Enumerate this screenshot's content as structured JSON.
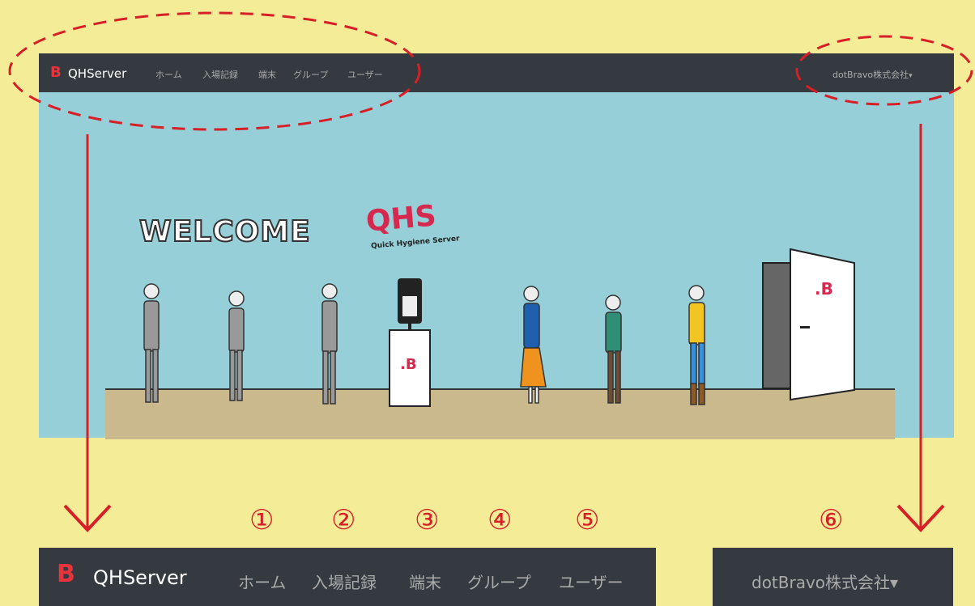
{
  "navbar": {
    "brand_mark": "B",
    "brand_name": "QHServer",
    "items": [
      {
        "label": "ホーム",
        "number": "①"
      },
      {
        "label": "入場記録",
        "number": "②"
      },
      {
        "label": "端末",
        "number": "③"
      },
      {
        "label": "グループ",
        "number": "④"
      },
      {
        "label": "ユーザー",
        "number": "⑤"
      }
    ],
    "user_menu": {
      "label": "dotBravo株式会社",
      "number": "⑥",
      "caret": "▾"
    }
  },
  "hero": {
    "welcome_text": "WELCOME",
    "logo_title": "QHS",
    "logo_subtitle": "Quick Hygiene Server",
    "door_mark": ".B",
    "stand_mark": ".B"
  },
  "colors": {
    "background": "#f5ec98",
    "navbar": "#343a40",
    "brand_red": "#e8323c",
    "annotation_red": "#d61f26",
    "scene_sky": "#96cfd8",
    "floor": "#c9b98d"
  }
}
